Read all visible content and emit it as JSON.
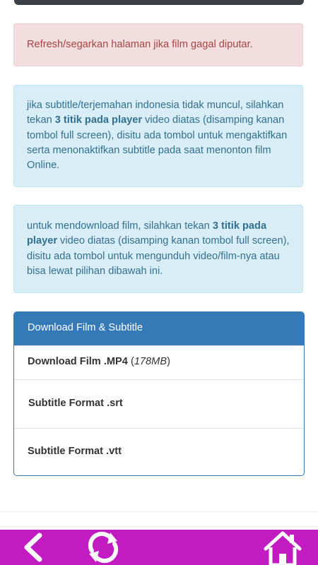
{
  "alert_refresh": "Refresh/segarkan halaman jika film gagal diputar.",
  "info_subtitle": {
    "before": "jika subtitle/terjemahan indonesia tidak muncul, silahkan tekan ",
    "bold": "3 titik pada player",
    "after": " video diatas (disamping kanan tombol full screen), disitu ada tombol untuk mengaktifkan serta menonaktifkan subtitle pada saat menonton film Online."
  },
  "info_download": {
    "before": "untuk mendownload film, silahkan tekan ",
    "bold": "3 titik pada player",
    "after": " video diatas (disamping kanan tombol full screen), disitu ada tombol untuk mengunduh video/film-nya atau bisa lewat pilihan dibawah ini."
  },
  "download_panel": {
    "title": "Download Film & Subtitle",
    "film_label": "Download Film .MP4",
    "film_size_open": " (",
    "film_size": "178MB",
    "film_size_close": ")",
    "srt_label": "Subtitle Format .srt",
    "vtt_label": "Subtitle Format .vtt"
  },
  "colors": {
    "panel_primary": "#337ab7",
    "bottom_bar": "#c21bc2",
    "danger_text": "#a94442",
    "info_text": "#31708f"
  },
  "icons": {
    "back": "chevron-left-icon",
    "refresh": "refresh-icon",
    "home": "home-icon"
  }
}
